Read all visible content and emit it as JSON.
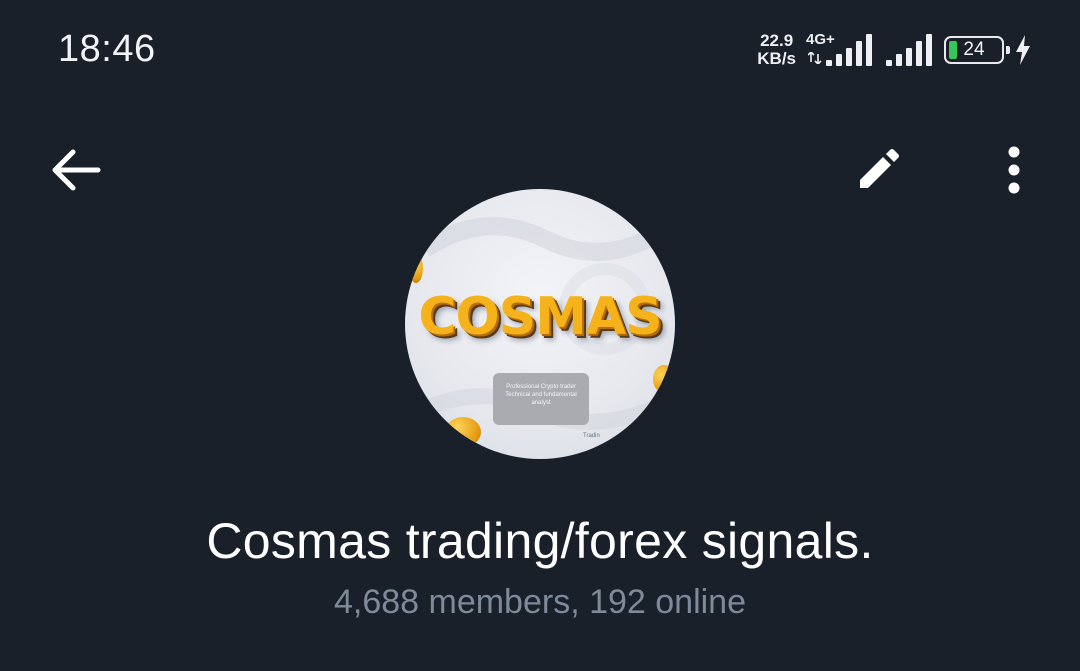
{
  "status_bar": {
    "time": "18:46",
    "speed_value": "22.9",
    "speed_unit": "KB/s",
    "network_type": "4G+",
    "battery_level": "24",
    "battery_color": "#35c759"
  },
  "toolbar": {
    "back_icon": "arrow-left-icon",
    "edit_icon": "pencil-icon",
    "more_icon": "more-vertical-icon"
  },
  "avatar": {
    "logo_text": "COSMAS",
    "card_lines": [
      "Professional Crypto trader",
      "Technical and fundamental",
      "analyst"
    ],
    "footer_text": "Tradin"
  },
  "chat": {
    "title": "Cosmas trading/forex signals.",
    "subtitle": "4,688 members, 192 online"
  },
  "colors": {
    "background": "#1a202a",
    "subtitle": "#7e8a99",
    "logo": "#f6b21a"
  }
}
